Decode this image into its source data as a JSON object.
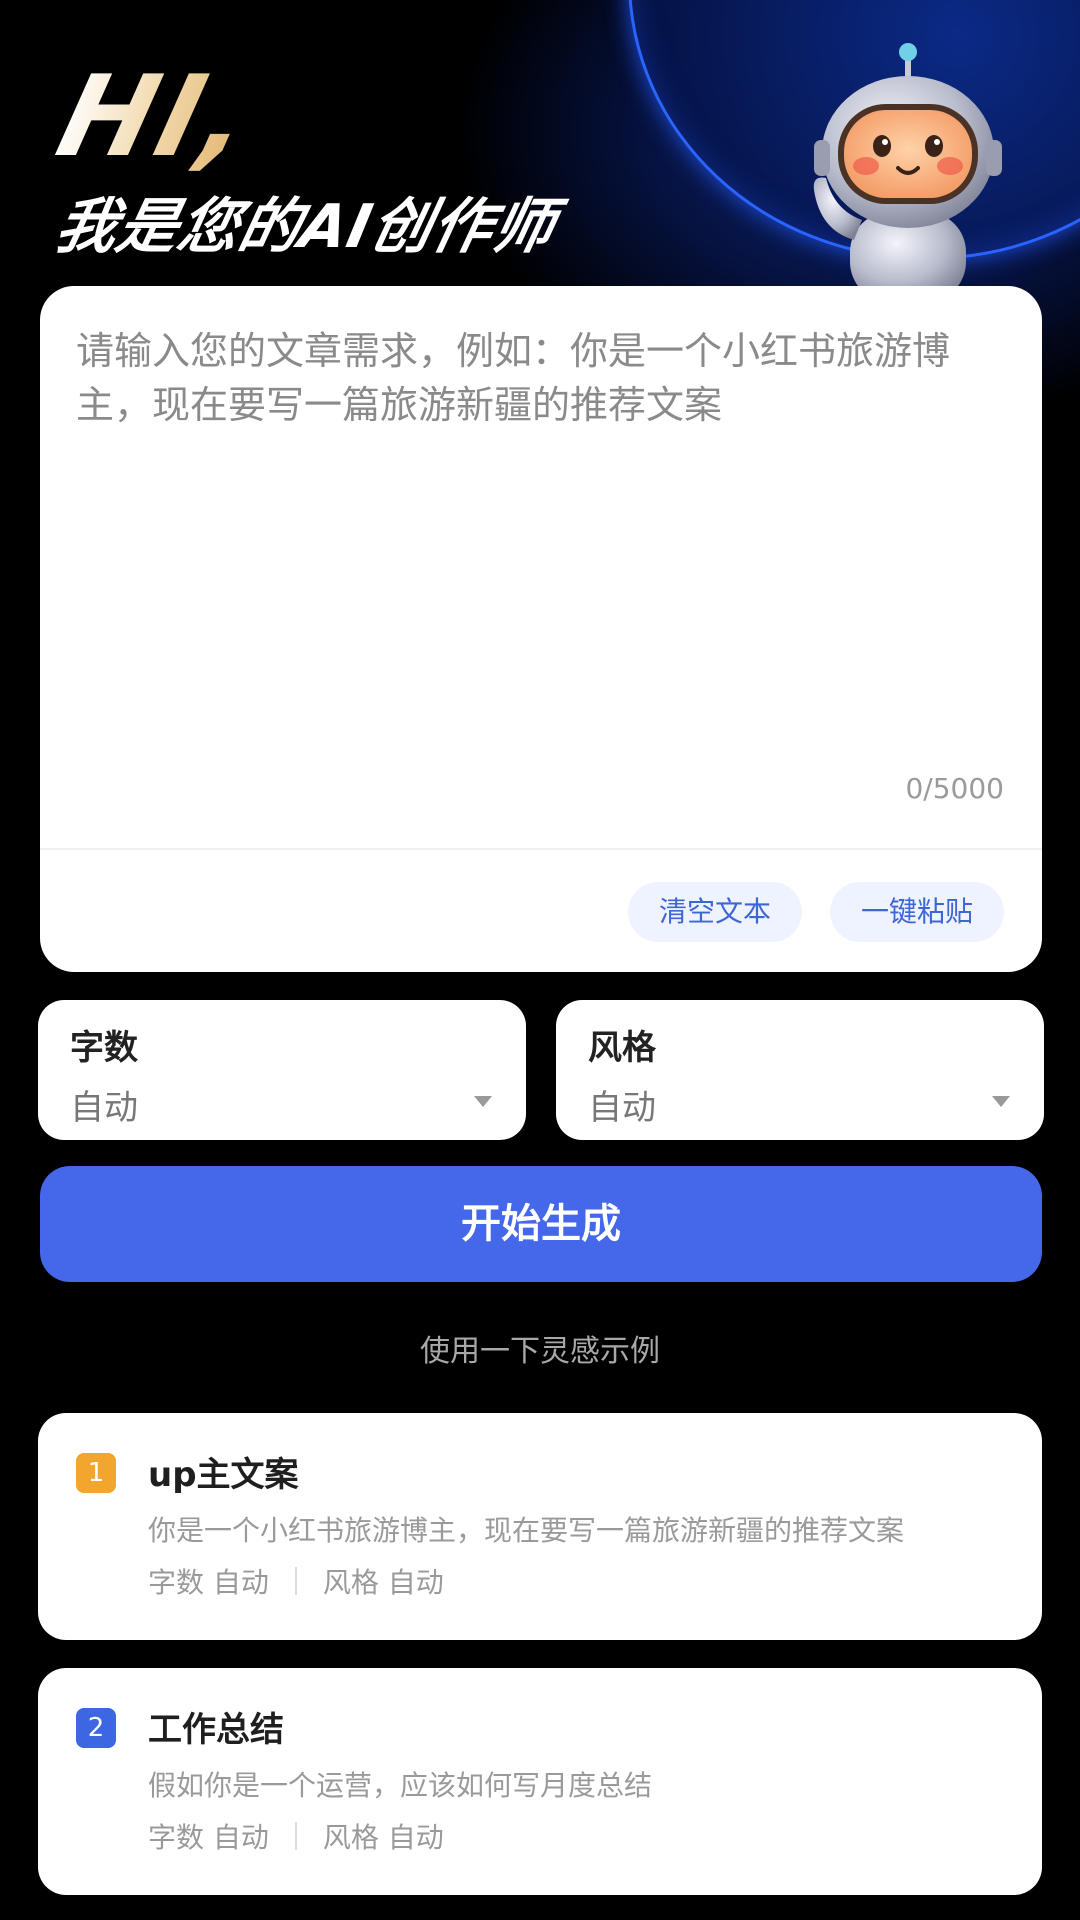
{
  "hero": {
    "greeting": "HI,",
    "subtitle": "我是您的AI创作师"
  },
  "input": {
    "placeholder": "请输入您的文章需求，例如：你是一个小红书旅游博主，现在要写一篇旅游新疆的推荐文案",
    "counter": "0/5000",
    "clear_label": "清空文本",
    "paste_label": "一键粘贴"
  },
  "options": {
    "words": {
      "label": "字数",
      "value": "自动"
    },
    "style": {
      "label": "风格",
      "value": "自动"
    }
  },
  "generate_label": "开始生成",
  "hint": "使用一下灵感示例",
  "examples": [
    {
      "index": "1",
      "title": "up主文案",
      "description": "你是一个小红书旅游博主，现在要写一篇旅游新疆的推荐文案",
      "words_meta": "字数 自动",
      "style_meta": "风格 自动"
    },
    {
      "index": "2",
      "title": "工作总结",
      "description": "假如你是一个运营，应该如何写月度总结",
      "words_meta": "字数 自动",
      "style_meta": "风格 自动"
    }
  ],
  "colors": {
    "accent": "#4567e9",
    "badge_orange": "#f2a62d",
    "badge_blue": "#3d66e2",
    "background": "#000000"
  },
  "icons": {
    "mascot": "astronaut-mascot-icon",
    "dropdown": "triangle-down-icon"
  }
}
